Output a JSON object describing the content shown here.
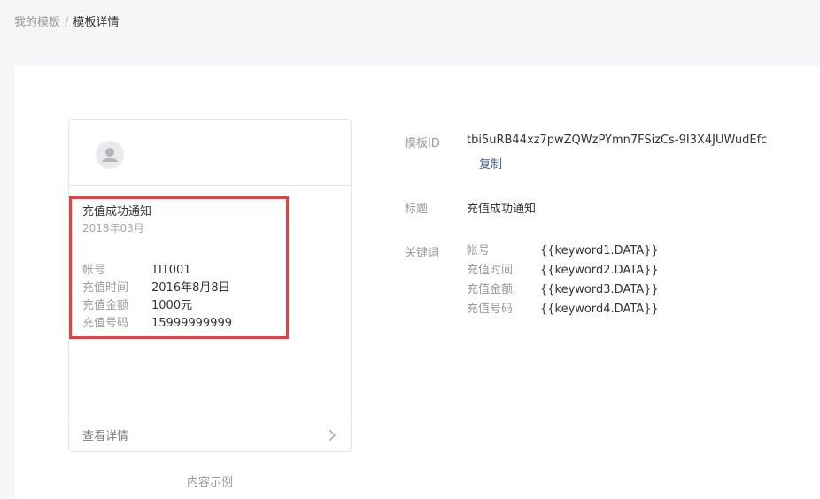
{
  "breadcrumb": {
    "parent": "我的模板",
    "separator": "/",
    "current": "模板详情"
  },
  "preview": {
    "avatar_icon": "user-avatar-icon",
    "message_title": "充值成功通知",
    "message_date": "2018年03月",
    "fields": [
      {
        "key": "帐号",
        "value": "TIT001"
      },
      {
        "key": "充值时间",
        "value": "2016年8月8日"
      },
      {
        "key": "充值金额",
        "value": "1000元"
      },
      {
        "key": "充值号码",
        "value": "15999999999"
      }
    ],
    "footer_label": "查看详情",
    "footer_icon": "chevron-right-icon",
    "caption": "内容示例",
    "highlight_color": "#f23b3b"
  },
  "details": {
    "template_id_label": "模板ID",
    "template_id_value": "tbi5uRB44xz7pwZQWzPYmn7FSizCs-9I3X4JUWudEfc",
    "copy_label": "复制",
    "title_label": "标题",
    "title_value": "充值成功通知",
    "keywords_label": "关键词",
    "keywords": [
      {
        "name": "帐号",
        "value": "{{keyword1.DATA}}"
      },
      {
        "name": "充值时间",
        "value": "{{keyword2.DATA}}"
      },
      {
        "name": "充值金额",
        "value": "{{keyword3.DATA}}"
      },
      {
        "name": "充值号码",
        "value": "{{keyword4.DATA}}"
      }
    ]
  },
  "colors": {
    "link": "#3e5f96",
    "page_bg": "#f5f6f7"
  }
}
